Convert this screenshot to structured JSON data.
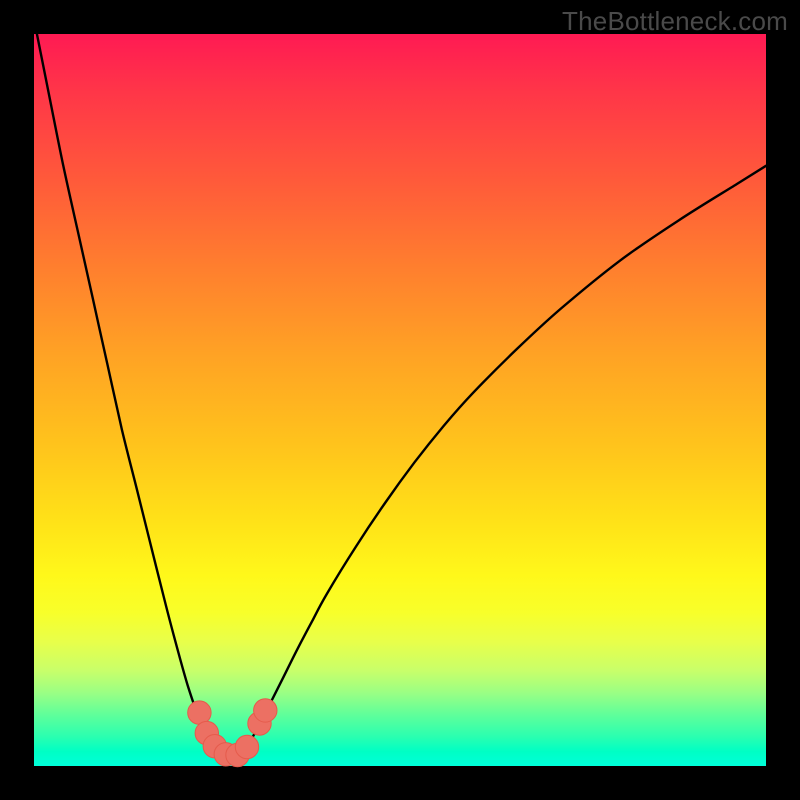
{
  "watermark": "TheBottleneck.com",
  "colors": {
    "frame": "#000000",
    "curve": "#000000",
    "marker_fill": "#ec7063",
    "marker_stroke": "#e55b4c"
  },
  "chart_data": {
    "type": "line",
    "title": "",
    "xlabel": "",
    "ylabel": "",
    "xlim": [
      0,
      100
    ],
    "ylim": [
      0,
      100
    ],
    "grid": false,
    "note": "No axis ticks or numeric labels are rendered; values are estimated from pixel positions on a 0–100 normalized scale.",
    "series": [
      {
        "name": "bottleneck-curve",
        "x": [
          0,
          2,
          4,
          6,
          8,
          10,
          12,
          14,
          16,
          18,
          20,
          21,
          22,
          23,
          24,
          25,
          26,
          27,
          28,
          29,
          30,
          31,
          32,
          34,
          36,
          38,
          40,
          44,
          48,
          52,
          56,
          60,
          66,
          72,
          80,
          88,
          96,
          100
        ],
        "y": [
          102,
          92,
          82,
          73,
          64,
          55,
          46,
          38,
          30,
          22,
          14.5,
          11,
          8,
          5.5,
          3.7,
          2.4,
          1.6,
          1.4,
          1.6,
          2.6,
          4.2,
          6,
          8,
          12,
          16,
          19.8,
          23.5,
          30,
          36,
          41.5,
          46.5,
          51,
          57,
          62.5,
          69,
          74.5,
          79.5,
          82
        ]
      }
    ],
    "markers": [
      {
        "x": 22.6,
        "y": 7.3,
        "r": 1.6
      },
      {
        "x": 23.6,
        "y": 4.5,
        "r": 1.6
      },
      {
        "x": 24.7,
        "y": 2.7,
        "r": 1.6
      },
      {
        "x": 26.2,
        "y": 1.6,
        "r": 1.6
      },
      {
        "x": 27.8,
        "y": 1.5,
        "r": 1.6
      },
      {
        "x": 29.1,
        "y": 2.6,
        "r": 1.6
      },
      {
        "x": 30.8,
        "y": 5.8,
        "r": 1.6
      },
      {
        "x": 31.6,
        "y": 7.6,
        "r": 1.6
      }
    ],
    "minimum": {
      "x": 27.0,
      "y": 1.4
    }
  }
}
